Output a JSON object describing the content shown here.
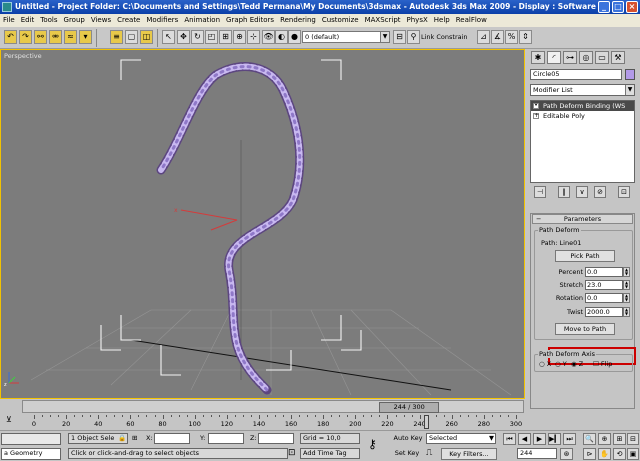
{
  "window": {
    "title": "Untitled     - Project Folder: C:\\Documents and Settings\\Tedd Permana\\My Documents\\3dsmax     - Autodesk 3ds Max  2009     - Display : Software",
    "minimize": "_",
    "maximize": "□",
    "close": "×"
  },
  "menu": [
    "File",
    "Edit",
    "Tools",
    "Group",
    "Views",
    "Create",
    "Modifiers",
    "Animation",
    "Graph Editors",
    "Rendering",
    "Customize",
    "MAXScript",
    "PhysX",
    "Help",
    "RealFlow"
  ],
  "toolbar": {
    "layer": "0 (default)",
    "link_constraint": "Link Constrain"
  },
  "viewport": {
    "label": "Perspective",
    "axis_x": "x",
    "axis_y": "y",
    "axis_z": "z"
  },
  "command_panel": {
    "object_name": "Circle05",
    "object_color": "#b39ae8",
    "modifier_list": "Modifier List",
    "stack": [
      {
        "label": "Path Deform Binding (WS",
        "selected": true
      },
      {
        "label": "Editable Poly",
        "selected": false
      }
    ],
    "rollout_title": "Parameters",
    "path_deform_group": "Path Deform",
    "path_label": "Path: Line01",
    "pick_path": "Pick Path",
    "percent_label": "Percent",
    "percent_value": "0.0",
    "stretch_label": "Stretch",
    "stretch_value": "23.0",
    "rotation_label": "Rotation",
    "rotation_value": "0.0",
    "twist_label": "Twist",
    "twist_value": "2000.0",
    "move_to_path": "Move to Path",
    "axis_group": "Path Deform Axis",
    "axis_x": "X",
    "axis_y": "Y",
    "axis_z": "Z",
    "flip": "Flip"
  },
  "timeline": {
    "slider_label": "244 / 300",
    "ticks": [
      0,
      20,
      40,
      60,
      80,
      100,
      120,
      140,
      160,
      180,
      200,
      220,
      240,
      260,
      280,
      300
    ],
    "current_frame": 244,
    "total_frames": 300
  },
  "status": {
    "script_tab": "a Geometry",
    "selection": "1 Object Sele",
    "x_label": "X:",
    "y_label": "Y:",
    "z_label": "Z:",
    "grid": "Grid = 10,0",
    "auto_key": "Auto Key",
    "selected_option": "Selected",
    "set_key": "Set Key",
    "key_filters": "Key Filters...",
    "frame_field": "244",
    "prompt": "Click or click-and-drag to select objects",
    "add_time_tag": "Add Time Tag"
  }
}
